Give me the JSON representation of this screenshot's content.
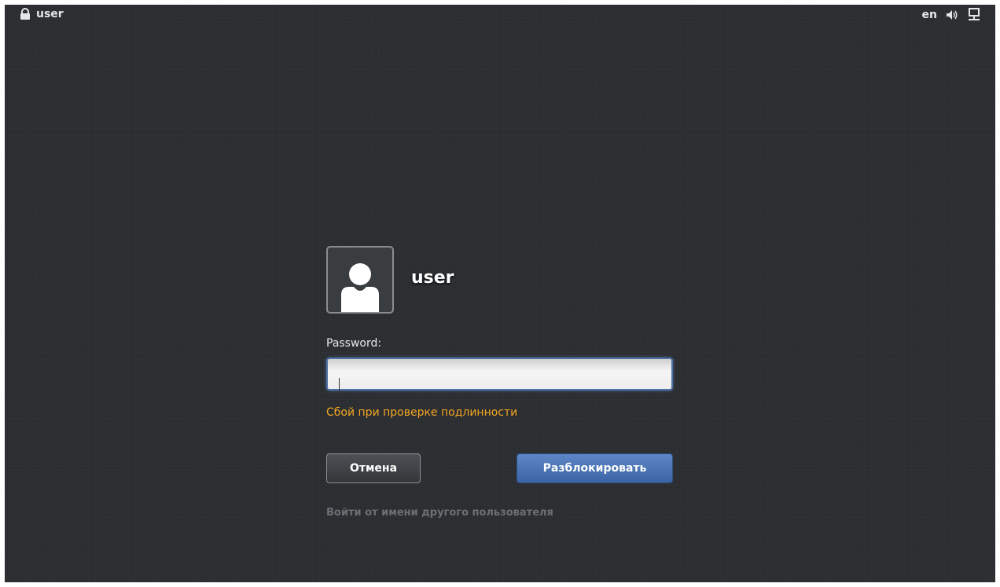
{
  "topbar": {
    "icon": "lock-icon",
    "user": "user",
    "language": "en",
    "tray_icons": [
      "volume-icon",
      "network-icon"
    ]
  },
  "dialog": {
    "avatar_icon": "user-avatar-icon",
    "user_name": "user",
    "password_label": "Password:",
    "password_value": "",
    "error_message": "Сбой при проверке подлинности",
    "cancel_label": "Отмена",
    "unlock_label": "Разблокировать",
    "other_user_link": "Войти от имени другого пользователя"
  },
  "colors": {
    "background": "#2b2e31",
    "error": "#f5a623",
    "accent": "#4f73a8"
  }
}
